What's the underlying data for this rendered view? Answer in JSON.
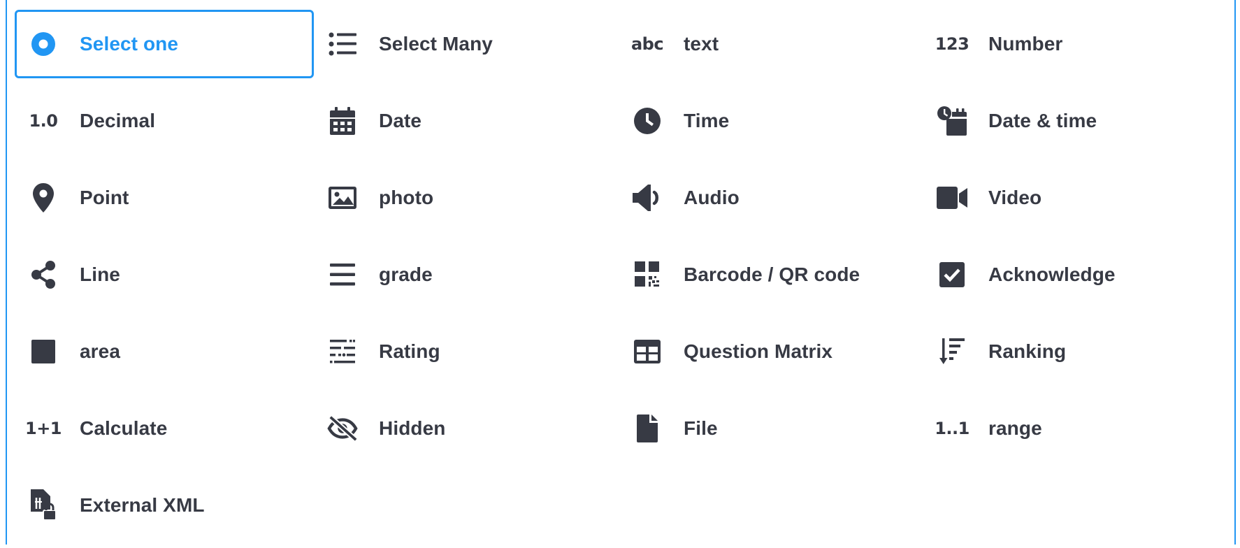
{
  "question_types": [
    {
      "label": "Select one",
      "icon": "radio-button-icon",
      "selected": true
    },
    {
      "label": "Select Many",
      "icon": "checklist-icon"
    },
    {
      "label": "text",
      "icon": "text-abc-icon",
      "icon_text": "abc"
    },
    {
      "label": "Number",
      "icon": "number-123-icon",
      "icon_text": "123"
    },
    {
      "label": "Decimal",
      "icon": "decimal-icon",
      "icon_text": "1.0"
    },
    {
      "label": "Date",
      "icon": "calendar-icon"
    },
    {
      "label": "Time",
      "icon": "clock-icon"
    },
    {
      "label": "Date & time",
      "icon": "date-time-icon"
    },
    {
      "label": "Point",
      "icon": "map-pin-icon"
    },
    {
      "label": "photo",
      "icon": "image-icon"
    },
    {
      "label": "Audio",
      "icon": "speaker-icon"
    },
    {
      "label": "Video",
      "icon": "video-camera-icon"
    },
    {
      "label": "Line",
      "icon": "share-nodes-icon"
    },
    {
      "label": "grade",
      "icon": "lines-icon"
    },
    {
      "label": "Barcode / QR code",
      "icon": "qr-code-icon"
    },
    {
      "label": "Acknowledge",
      "icon": "checkbox-checked-icon"
    },
    {
      "label": "area",
      "icon": "square-icon"
    },
    {
      "label": "Rating",
      "icon": "rating-sliders-icon"
    },
    {
      "label": "Question Matrix",
      "icon": "table-grid-icon"
    },
    {
      "label": "Ranking",
      "icon": "sort-descending-icon"
    },
    {
      "label": "Calculate",
      "icon": "calculate-icon",
      "icon_text": "1+1"
    },
    {
      "label": "Hidden",
      "icon": "eye-slash-icon"
    },
    {
      "label": "File",
      "icon": "file-icon"
    },
    {
      "label": "range",
      "icon": "range-icon",
      "icon_text": "1..1"
    },
    {
      "label": "External XML",
      "icon": "file-lock-icon"
    }
  ],
  "colors": {
    "accent": "#2196f3",
    "text": "#373a44",
    "background": "#ffffff"
  }
}
